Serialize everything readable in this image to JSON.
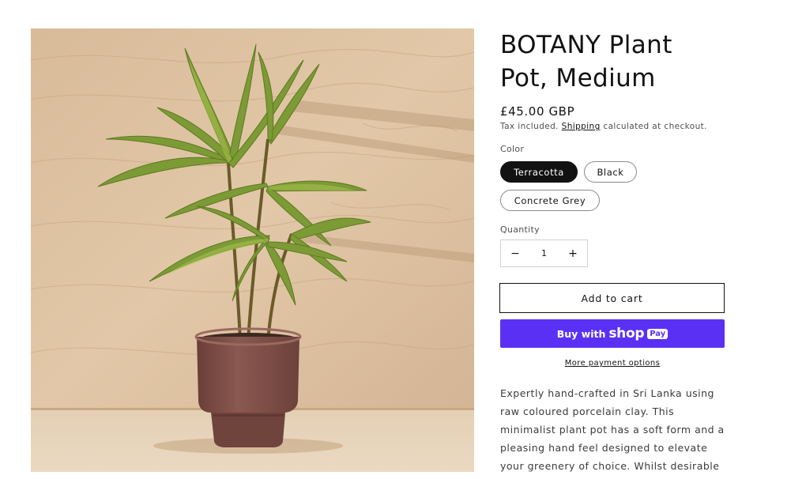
{
  "product": {
    "title": "BOTANY Plant Pot, Medium",
    "price": "£45.00 GBP",
    "tax_text_before": "Tax included.",
    "tax_link": "Shipping",
    "tax_text_after": "calculated at checkout.",
    "description": "Expertly hand-crafted in Sri Lanka using raw coloured porcelain clay. This minimalist plant pot has a soft form and a pleasing hand feel designed to elevate your greenery of choice. Whilst desirable"
  },
  "color": {
    "label": "Color",
    "selected": "Terracotta",
    "options": [
      "Terracotta",
      "Black",
      "Concrete Grey"
    ]
  },
  "quantity": {
    "label": "Quantity",
    "value": "1",
    "decrease": "−",
    "increase": "+"
  },
  "actions": {
    "add_to_cart": "Add to cart",
    "buy_with": "Buy with",
    "shop": "shop",
    "pay": "Pay",
    "more_payment": "More payment options"
  },
  "colors": {
    "accent_shop_pay": "#5a31f4",
    "selected_swatch": "#121212",
    "pot": "#7a4a42"
  },
  "image": {
    "icon": "product-photo-plant-in-pot"
  }
}
